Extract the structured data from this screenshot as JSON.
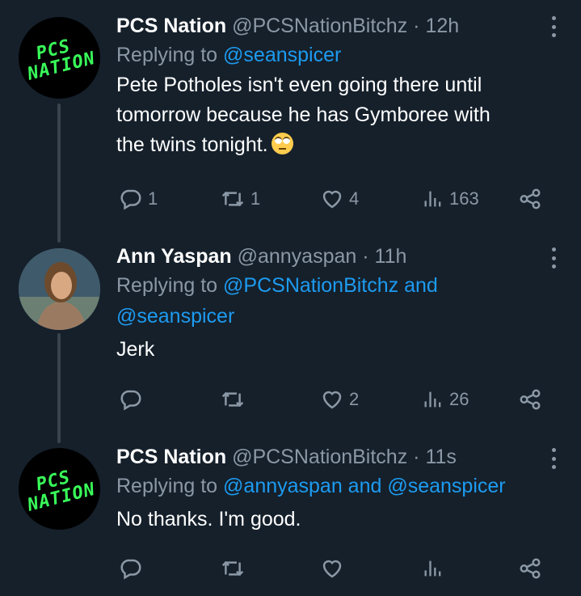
{
  "tweets": [
    {
      "name": "PCS Nation",
      "handle": "@PCSNationBitchz",
      "time": "12h",
      "reply_prefix": "Replying to",
      "reply_mentions": "@seanspicer",
      "text_lines": [
        "Pete Potholes isn't even going there until",
        "tomorrow because he has Gymboree with",
        "the twins tonight."
      ],
      "emoji": "face-with-rolling-eyes",
      "stats": {
        "replies": "1",
        "retweets": "1",
        "likes": "4",
        "views": "163"
      },
      "avatar_text": [
        "PCS",
        "NATION"
      ]
    },
    {
      "name": "Ann Yaspan",
      "handle": "@annyaspan",
      "time": "11h",
      "reply_prefix": "Replying to",
      "reply_mentions_line1": "@PCSNationBitchz and",
      "reply_mentions_line2": "@seanspicer",
      "text": "Jerk",
      "stats": {
        "replies": "",
        "retweets": "",
        "likes": "2",
        "views": "26"
      }
    },
    {
      "name": "PCS Nation",
      "handle": "@PCSNationBitchz",
      "time": "11s",
      "reply_prefix": "Replying to",
      "reply_mentions": "@annyaspan and @seanspicer",
      "text": "No thanks. I'm good.",
      "stats": {
        "replies": "",
        "retweets": "",
        "likes": "",
        "views": ""
      },
      "avatar_text": [
        "PCS",
        "NATION"
      ]
    }
  ],
  "separator": "·",
  "colors": {
    "background": "#15202b",
    "accent": "#1d9bf0",
    "muted": "#8b98a5",
    "logo_green": "#39ff5a"
  }
}
